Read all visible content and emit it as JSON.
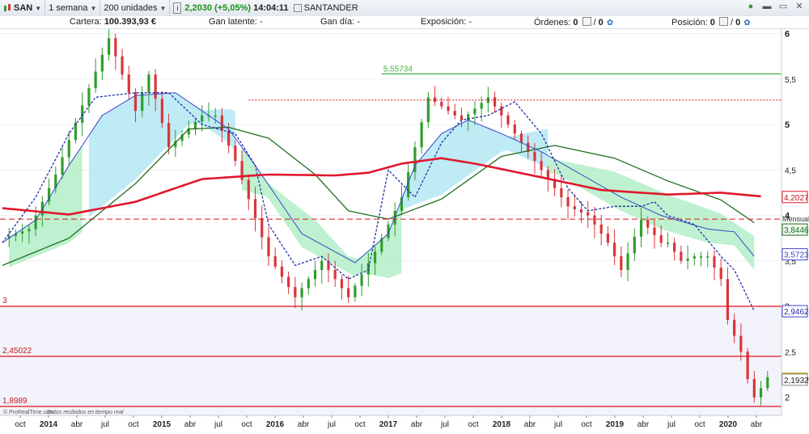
{
  "toolbar": {
    "symbol": "SAN",
    "period": "1 semana",
    "units": "200 unidades",
    "price": "2,2030",
    "change": "(+5,05%)",
    "time": "14:04:11",
    "name": "SANTANDER"
  },
  "infobar": {
    "cartera_label": "Cartera:",
    "cartera_value": "100.393,93 €",
    "gan_latente_label": "Gan latente:",
    "gan_latente_value": "-",
    "gan_dia_label": "Gan día:",
    "gan_dia_value": "-",
    "exposicion_label": "Exposición:",
    "exposicion_value": "-",
    "ordenes_label": "Órdenes:",
    "ordenes_value": "0",
    "ordenes_value2": "0",
    "posicion_label": "Posición:",
    "posicion_value": "0",
    "posicion_value2": "0"
  },
  "colors": {
    "price_up": "#2e9e2e",
    "price_down": "#d9353a",
    "ma_red": "#e0182d",
    "ma_dark_green": "#1f6e1f",
    "ma_blue": "#3a46c8",
    "cloud_green": "#a8ecbf",
    "cloud_blue": "#a9e4f2",
    "hline": "#e0141e",
    "resist_green": "#3fb53f"
  },
  "chart_data": {
    "type": "candlestick",
    "timeframe": "weekly",
    "y_ticks": [
      "6",
      "5,5",
      "5",
      "4,5",
      "4",
      "3,5",
      "3",
      "2,5",
      "2"
    ],
    "ylim": [
      1.8,
      6.05
    ],
    "x_ticks": [
      "oct",
      "2014",
      "abr",
      "jul",
      "oct",
      "2015",
      "abr",
      "jul",
      "oct",
      "2016",
      "abr",
      "jul",
      "oct",
      "2017",
      "abr",
      "jul",
      "oct",
      "2018",
      "abr",
      "jul",
      "oct",
      "2019",
      "abr",
      "jul",
      "oct",
      "2020",
      "abr"
    ],
    "x_ticks_bold": [
      "2014",
      "2015",
      "2016",
      "2017",
      "2018",
      "2019",
      "2020"
    ],
    "price_path": [
      [
        0,
        3.75
      ],
      [
        4,
        3.85
      ],
      [
        8,
        4.45
      ],
      [
        13,
        5.4
      ],
      [
        16,
        5.95
      ],
      [
        20,
        5.15
      ],
      [
        22,
        5.55
      ],
      [
        25,
        4.75
      ],
      [
        30,
        5.1
      ],
      [
        32,
        5.1
      ],
      [
        35,
        4.6
      ],
      [
        40,
        3.55
      ],
      [
        44,
        3.1
      ],
      [
        48,
        3.5
      ],
      [
        52,
        3.1
      ],
      [
        56,
        3.6
      ],
      [
        60,
        4.2
      ],
      [
        64,
        5.3
      ],
      [
        69,
        5.05
      ],
      [
        73,
        5.3
      ],
      [
        76,
        5.0
      ],
      [
        80,
        4.6
      ],
      [
        85,
        4.1
      ],
      [
        88,
        4.0
      ],
      [
        91,
        3.7
      ],
      [
        93,
        3.4
      ],
      [
        96,
        3.95
      ],
      [
        99,
        3.7
      ],
      [
        100,
        3.7
      ],
      [
        102,
        3.5
      ],
      [
        104,
        3.55
      ],
      [
        106,
        3.55
      ],
      [
        108,
        3.3
      ],
      [
        109,
        2.85
      ],
      [
        111,
        2.5
      ],
      [
        112,
        2.2
      ],
      [
        113,
        2.0
      ],
      [
        114,
        2.1
      ],
      [
        115,
        2.22
      ]
    ],
    "overlays": {
      "ma_red": [
        [
          0,
          4.08
        ],
        [
          10,
          4.01
        ],
        [
          20,
          4.15
        ],
        [
          30,
          4.4
        ],
        [
          40,
          4.45
        ],
        [
          50,
          4.44
        ],
        [
          55,
          4.47
        ],
        [
          60,
          4.57
        ],
        [
          66,
          4.63
        ],
        [
          71,
          4.57
        ],
        [
          79,
          4.45
        ],
        [
          90,
          4.28
        ],
        [
          100,
          4.23
        ],
        [
          108,
          4.25
        ],
        [
          114,
          4.21
        ]
      ],
      "ma_dark_green": [
        [
          0,
          3.45
        ],
        [
          10,
          3.75
        ],
        [
          20,
          4.35
        ],
        [
          28,
          4.95
        ],
        [
          34,
          4.97
        ],
        [
          40,
          4.85
        ],
        [
          47,
          4.45
        ],
        [
          52,
          4.05
        ],
        [
          58,
          3.96
        ],
        [
          66,
          4.18
        ],
        [
          75,
          4.65
        ],
        [
          83,
          4.77
        ],
        [
          92,
          4.63
        ],
        [
          100,
          4.38
        ],
        [
          108,
          4.17
        ],
        [
          113,
          3.92
        ]
      ],
      "ma_blue": [
        [
          0,
          3.7
        ],
        [
          5,
          3.95
        ],
        [
          10,
          4.55
        ],
        [
          15,
          5.1
        ],
        [
          20,
          5.32
        ],
        [
          26,
          5.35
        ],
        [
          34,
          4.95
        ],
        [
          38,
          4.55
        ],
        [
          45,
          3.8
        ],
        [
          53,
          3.48
        ],
        [
          58,
          3.8
        ],
        [
          62,
          4.55
        ],
        [
          66,
          4.9
        ],
        [
          70,
          5.05
        ],
        [
          75,
          4.9
        ],
        [
          81,
          4.7
        ],
        [
          87,
          4.45
        ],
        [
          93,
          4.2
        ],
        [
          99,
          4.0
        ],
        [
          106,
          3.85
        ],
        [
          110,
          3.82
        ],
        [
          113,
          3.55
        ]
      ],
      "ma_blue_dotted": [
        [
          0,
          3.7
        ],
        [
          5,
          4.2
        ],
        [
          10,
          4.9
        ],
        [
          14,
          5.3
        ],
        [
          20,
          5.35
        ],
        [
          25,
          5.35
        ],
        [
          30,
          5.0
        ],
        [
          35,
          4.9
        ],
        [
          38,
          4.55
        ],
        [
          40,
          3.9
        ],
        [
          44,
          3.45
        ],
        [
          48,
          3.55
        ],
        [
          52,
          3.3
        ],
        [
          55,
          3.4
        ],
        [
          58,
          4.5
        ],
        [
          62,
          4.2
        ],
        [
          66,
          4.8
        ],
        [
          69,
          5.05
        ],
        [
          73,
          5.1
        ],
        [
          77,
          5.25
        ],
        [
          81,
          4.9
        ],
        [
          85,
          4.3
        ],
        [
          88,
          4.05
        ],
        [
          92,
          4.1
        ],
        [
          96,
          4.1
        ],
        [
          98,
          4.15
        ],
        [
          100,
          4.0
        ],
        [
          104,
          3.9
        ],
        [
          108,
          3.55
        ],
        [
          110,
          3.4
        ],
        [
          113,
          2.95
        ]
      ]
    },
    "levels": {
      "resistance_green": "5,55734",
      "dotted_red": 5.27,
      "dashed_mensual": 3.96,
      "line_3": "3",
      "line_2_45": "2,45022",
      "line_1_9": "1,8989"
    },
    "right_labels": {
      "ma_red_value": "4,2027",
      "mensual_label": "Mensual",
      "ma_dark_green_value": "3,8446",
      "ma_blue_value": "3,5723",
      "ma_blue_dotted_value": "2,9462",
      "last_price": "2,2030",
      "other_price": "2,1932"
    },
    "left_labels": {
      "line_3": "3",
      "line_2_45": "2,45022",
      "line_1_9": "1,8989"
    },
    "footer_credit": "© ProRealTime.com",
    "footer_note": "Datos recibidos en tiempo real"
  }
}
